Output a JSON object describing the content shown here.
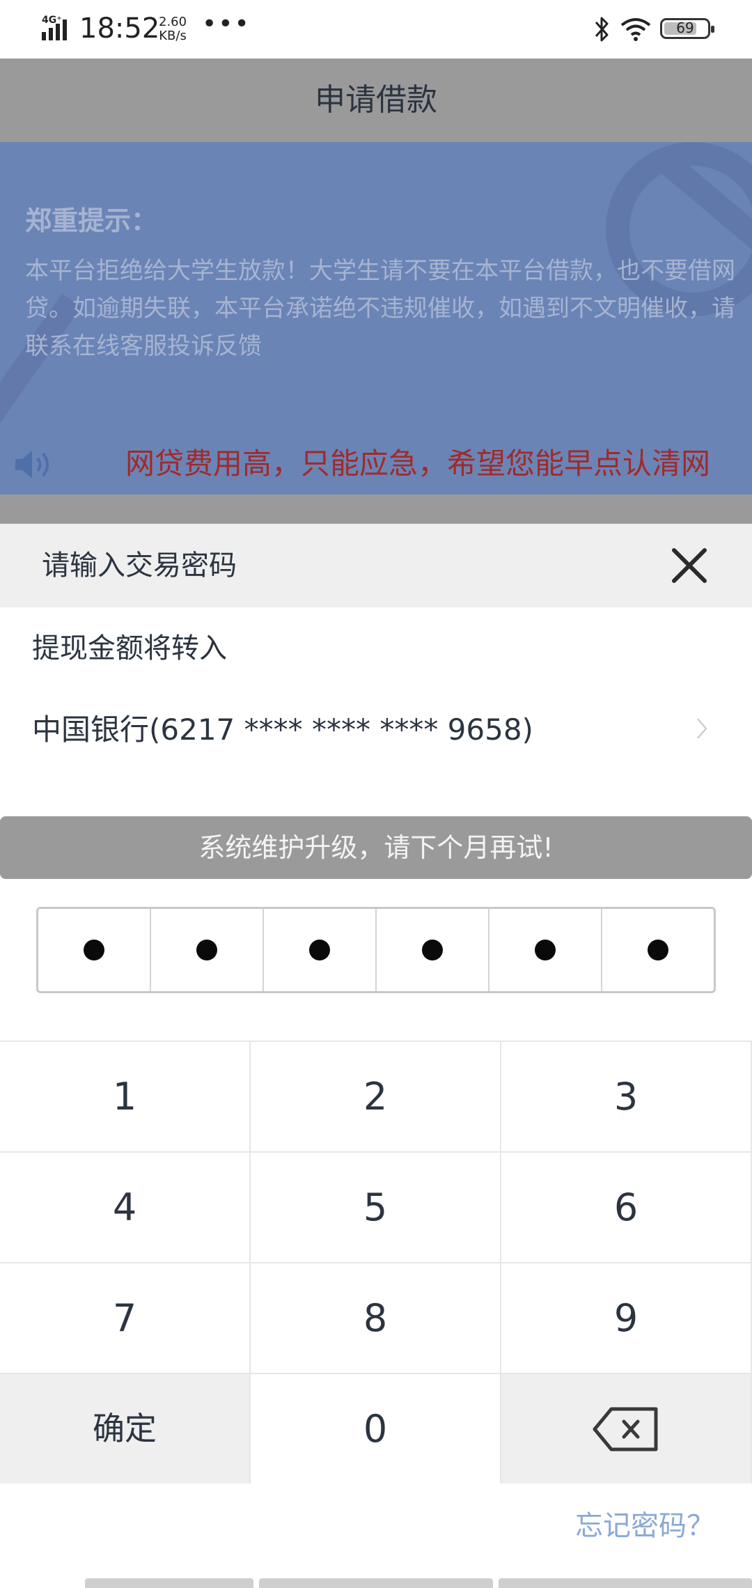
{
  "status_bar": {
    "network": "4G⁺",
    "time": "18:52",
    "speed_value": "2.60",
    "speed_unit": "KB/s",
    "dots": "•••",
    "battery": "69"
  },
  "header": {
    "title": "申请借款"
  },
  "notice": {
    "heading": "郑重提示：",
    "body": "本平台拒绝给大学生放款！大学生请不要在本平台借款，也不要借网贷。如逾期失联，本平台承诺绝不违规催收，如遇到不文明催收，请联系在线客服投诉反馈"
  },
  "marquee": {
    "text": "网贷费用高，只能应急，希望您能早点认清网"
  },
  "password_sheet": {
    "title": "请输入交易密码",
    "transfer_label": "提现金额将转入",
    "bank": "中国银行(6217 **** **** **** 9658)",
    "maintenance": "系统维护升级，请下个月再试!",
    "pin_length": 6,
    "pin_filled": 6
  },
  "keypad": {
    "keys": [
      "1",
      "2",
      "3",
      "4",
      "5",
      "6",
      "7",
      "8",
      "9"
    ],
    "confirm": "确定",
    "zero": "0"
  },
  "forgot": {
    "label": "忘记密码？"
  },
  "colors": {
    "header_bg": "#9a9a9a",
    "notice_bg": "#6b84b6",
    "marquee_text": "#a02a2a",
    "link": "#8aa8d8"
  },
  "icons": [
    "signal-icon",
    "bluetooth-icon",
    "wifi-icon",
    "battery-icon",
    "speaker-icon",
    "close-icon",
    "chevron-right-icon",
    "backspace-icon"
  ]
}
